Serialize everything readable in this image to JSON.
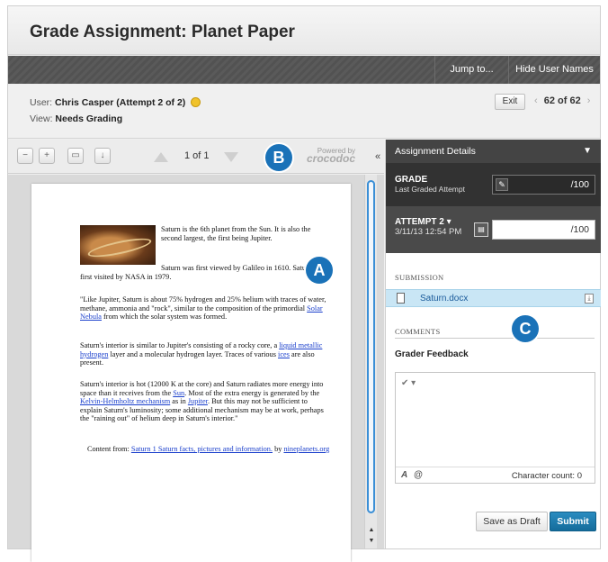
{
  "header": {
    "title": "Grade Assignment: Planet Paper"
  },
  "top_bar": {
    "jump_to": "Jump to...",
    "hide_user_names": "Hide User Names"
  },
  "user": {
    "user_label": "User:",
    "user_name": "Chris Casper (Attempt 2 of 2)",
    "view_label": "View:",
    "view_value": "Needs Grading",
    "exit": "Exit",
    "prev": "‹",
    "next": "›",
    "position": "62 of 62"
  },
  "viewer": {
    "page_indicator": "1 of 1",
    "powered_by": "Powered by",
    "brand": "crocodoc",
    "collapse": "«",
    "doc": {
      "intro": "Saturn is the 6th planet from the Sun. It is also the second largest, the first being Jupiter.",
      "p2": "Saturn was first viewed by Galileo in 1610. Saturn was first visited by NASA in 1979.",
      "p3_a": "\"Like Jupiter, Saturn is about 75% hydrogen and 25% helium with traces of water, methane, ammonia and \"rock\", similar to the composition of the primordial ",
      "p3_link": "Solar Nebula",
      "p3_b": " from which the solar system was formed.",
      "p4_a": "Saturn's interior is similar to Jupiter's consisting of a rocky core, a ",
      "p4_link1": "liquid metallic hydrogen",
      "p4_b": " layer and a molecular hydrogen layer. Traces of various ",
      "p4_link2": "ices",
      "p4_c": " are also present.",
      "p5_a": "Saturn's interior is hot (12000 K at the core) and Saturn radiates more energy into space than it receives from the ",
      "p5_link1": "Sun",
      "p5_b": ". Most of the extra energy is generated by the ",
      "p5_link2": "Kelvin-Helmholtz mechanism",
      "p5_c": " as in ",
      "p5_link3": "Jupiter",
      "p5_d": ". But this may not be sufficient to explain Saturn's luminosity; some additional mechanism may be at work, perhaps the \"raining out\" of helium deep in Saturn's interior.\"",
      "p6_a": "Content from: ",
      "p6_link1": "Saturn 1 Saturn facts, pictures and information.",
      "p6_b": " by ",
      "p6_link2": "nineplanets.org"
    }
  },
  "callouts": {
    "a": "A",
    "b": "B",
    "c": "C"
  },
  "panel": {
    "title": "Assignment Details",
    "grade_label": "GRADE",
    "grade_sub": "Last Graded Attempt",
    "grade_value": "/100",
    "attempt_label": "ATTEMPT 2",
    "attempt_date": "3/11/13 12:54 PM",
    "attempt_value": "/100",
    "submission_label": "SUBMISSION",
    "file_name": "Saturn.docx",
    "comments_label": "COMMENTS",
    "feedback_label": "Grader Feedback",
    "character_count": "Character count: 0",
    "save_draft": "Save as Draft",
    "submit": "Submit"
  },
  "colors": {
    "accent": "#1a72b8",
    "submit": "#146c9b",
    "file_highlight": "#c9e6f5",
    "dark_bar": "#555555"
  }
}
